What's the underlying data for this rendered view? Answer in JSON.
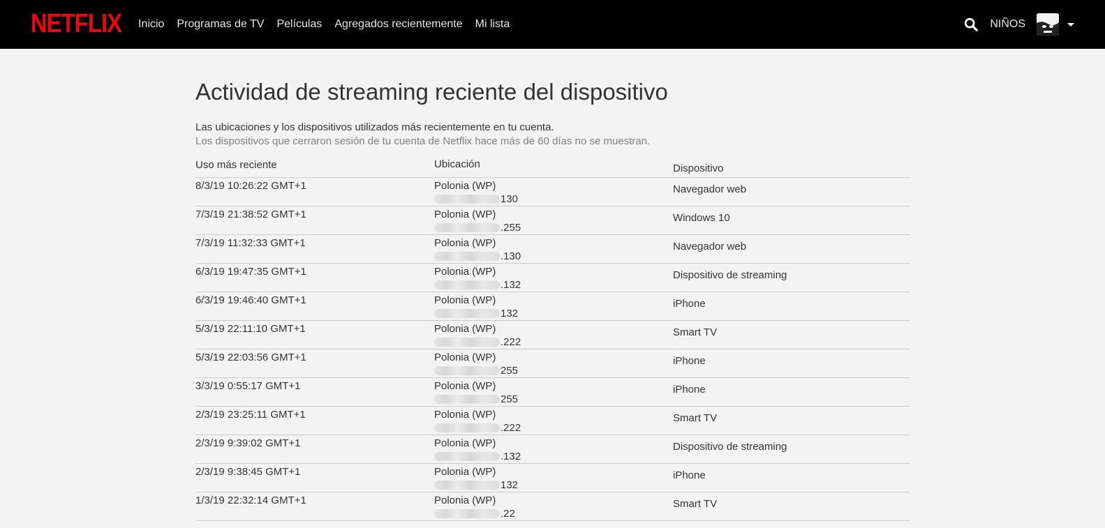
{
  "header": {
    "logo": "NETFLIX",
    "nav": [
      "Inicio",
      "Programas de TV",
      "Películas",
      "Agregados recientemente",
      "Mi lista"
    ],
    "kids": "NIÑOS",
    "icons": [
      "search-icon",
      "avatar",
      "caret-down-icon"
    ],
    "colors": {
      "brand": "#e50914",
      "bar": "#000000"
    }
  },
  "page": {
    "title": "Actividad de streaming reciente del dispositivo",
    "desc1": "Las ubicaciones y los dispositivos utilizados más recientemente en tu cuenta.",
    "desc2": "Los dispositivos que cerraron sesión de tu cuenta de Netflix hace más de 60 días no se muestran."
  },
  "table": {
    "headers": [
      "Uso más reciente",
      "Ubicación",
      "Dispositivo"
    ],
    "rows": [
      {
        "date": "8/3/19 10:26:22 GMT+1",
        "location": "Polonia (WP)",
        "ip": "130",
        "device": "Navegador web"
      },
      {
        "date": "7/3/19 21:38:52 GMT+1",
        "location": "Polonia (WP)",
        "ip": ".255",
        "device": "Windows 10"
      },
      {
        "date": "7/3/19 11:32:33 GMT+1",
        "location": "Polonia (WP)",
        "ip": ".130",
        "device": "Navegador web"
      },
      {
        "date": "6/3/19 19:47:35 GMT+1",
        "location": "Polonia (WP)",
        "ip": ".132",
        "device": "Dispositivo de streaming"
      },
      {
        "date": "6/3/19 19:46:40 GMT+1",
        "location": "Polonia (WP)",
        "ip": "132",
        "device": "iPhone"
      },
      {
        "date": "5/3/19 22:11:10 GMT+1",
        "location": "Polonia (WP)",
        "ip": ".222",
        "device": "Smart TV"
      },
      {
        "date": "5/3/19 22:03:56 GMT+1",
        "location": "Polonia (WP)",
        "ip": "255",
        "device": "iPhone"
      },
      {
        "date": "3/3/19 0:55:17 GMT+1",
        "location": "Polonia (WP)",
        "ip": "255",
        "device": "iPhone"
      },
      {
        "date": "2/3/19 23:25:11 GMT+1",
        "location": "Polonia (WP)",
        "ip": ".222",
        "device": "Smart TV"
      },
      {
        "date": "2/3/19 9:39:02 GMT+1",
        "location": "Polonia (WP)",
        "ip": ".132",
        "device": "Dispositivo de streaming"
      },
      {
        "date": "2/3/19 9:38:45 GMT+1",
        "location": "Polonia (WP)",
        "ip": "132",
        "device": "iPhone"
      },
      {
        "date": "1/3/19 22:32:14 GMT+1",
        "location": "Polonia (WP)",
        "ip": ".22",
        "device": "Smart TV"
      }
    ]
  }
}
